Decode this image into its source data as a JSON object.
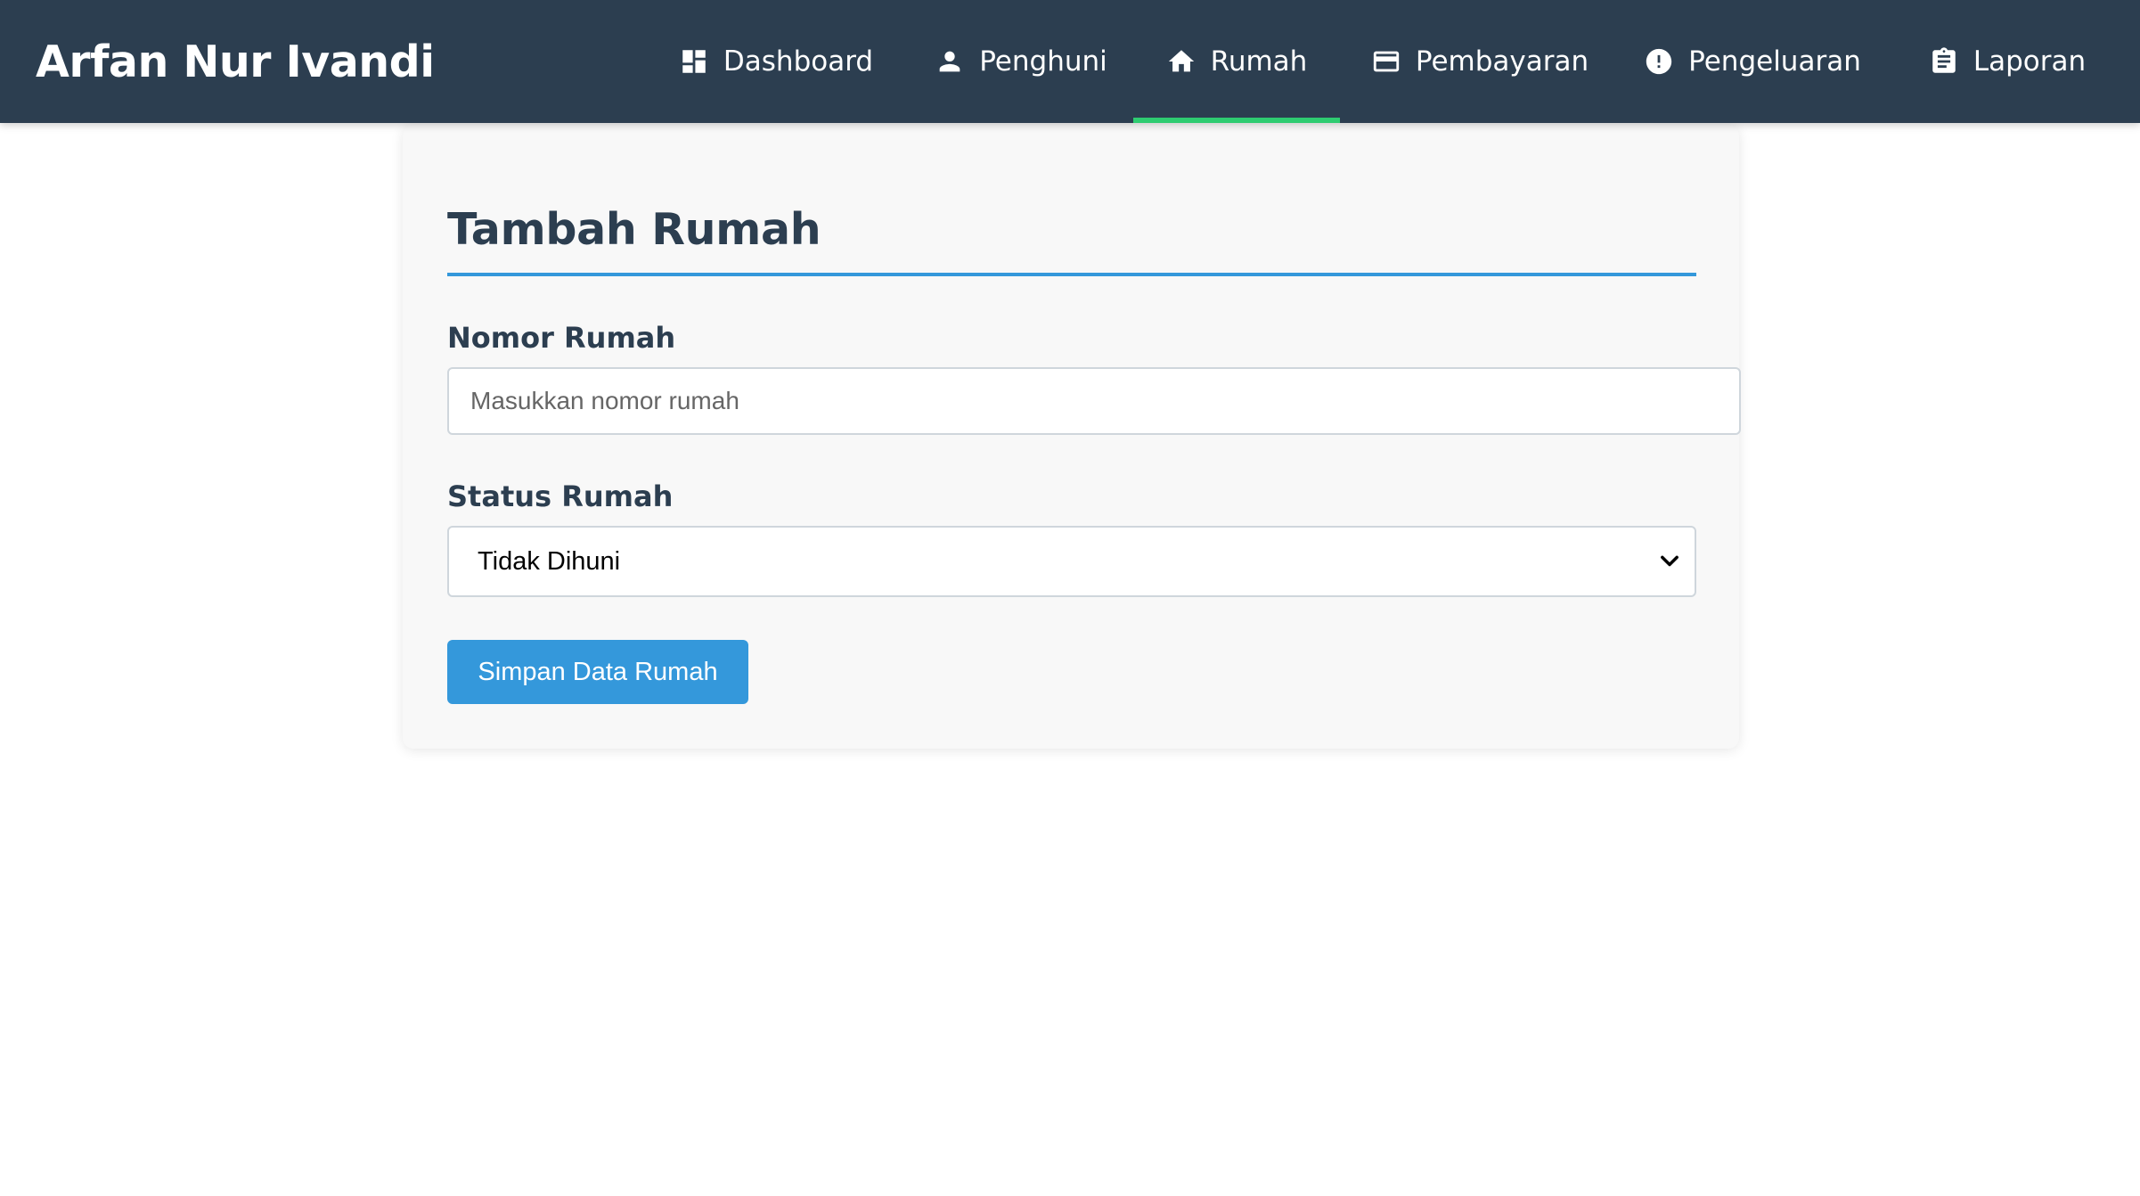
{
  "brand": {
    "title": "Arfan Nur Ivandi"
  },
  "nav": {
    "items": [
      {
        "label": "Dashboard",
        "icon": "dashboard-icon"
      },
      {
        "label": "Penghuni",
        "icon": "person-icon"
      },
      {
        "label": "Rumah",
        "icon": "home-icon",
        "active": true
      },
      {
        "label": "Pembayaran",
        "icon": "credit-card-icon"
      },
      {
        "label": "Pengeluaran",
        "icon": "alert-circle-icon"
      },
      {
        "label": "Laporan",
        "icon": "clipboard-icon"
      }
    ],
    "active_color": "#2ecc71"
  },
  "form": {
    "title": "Tambah Rumah",
    "nomor": {
      "label": "Nomor Rumah",
      "value": "",
      "placeholder": "Masukkan nomor rumah"
    },
    "status": {
      "label": "Status Rumah",
      "selected": "Tidak Dihuni"
    },
    "submit_label": "Simpan Data Rumah"
  },
  "colors": {
    "navbar": "#2c3e50",
    "accent": "#3498db",
    "active_underline": "#2ecc71"
  }
}
